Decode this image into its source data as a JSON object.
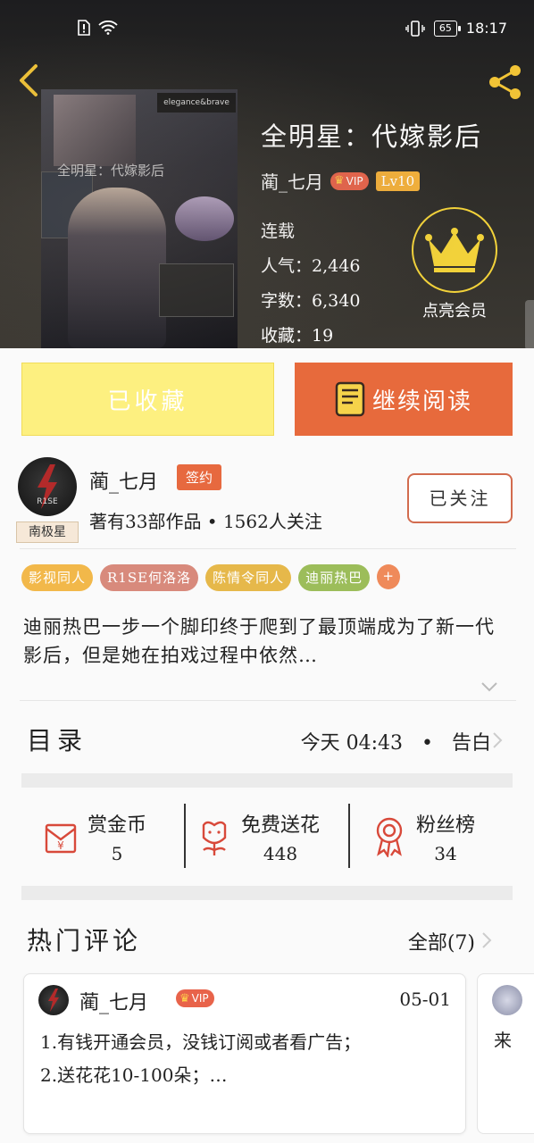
{
  "statusbar": {
    "time": "18:17",
    "battery": "65"
  },
  "book": {
    "title": "全明星：代嫁影后",
    "author": "蔺_七月",
    "vip_label": "VIP",
    "level": "Lv10",
    "cover_text": "elegance&brave",
    "cover_title": "全明星：代嫁影后",
    "status": "连载",
    "popularity_label": "人气：",
    "popularity": "2,446",
    "words_label": "字数：",
    "words": "6,340",
    "favorites_label": "收藏：",
    "favorites": "19"
  },
  "vip_member": {
    "label": "点亮会员"
  },
  "actions": {
    "collected": "已收藏",
    "continue_reading": "继续阅读"
  },
  "author_card": {
    "name": "蔺_七月",
    "signed": "签约",
    "avatar_tag": "南极星",
    "avatar_text": "R1SE",
    "meta": "著有33部作品 • 1562人关注",
    "follow": "已关注"
  },
  "tags": [
    {
      "label": "影视同人",
      "color": "#f2b84a"
    },
    {
      "label": "R1SE何洛洛",
      "color": "#d88a7c"
    },
    {
      "label": "陈情令同人",
      "color": "#e6b84a"
    },
    {
      "label": "迪丽热巴",
      "color": "#9cbd5a"
    },
    {
      "label": "+",
      "color": "#ef8a5a"
    }
  ],
  "synopsis": "迪丽热巴一步一个脚印终于爬到了最顶端成为了新一代影后，但是她在拍戏过程中依然…",
  "toc": {
    "title": "目录",
    "latest_time": "今天 04:43",
    "separator": "•",
    "latest_chapter": "告白"
  },
  "rewards": [
    {
      "label": "赏金币",
      "value": "5",
      "icon": "red-envelope-icon"
    },
    {
      "label": "免费送花",
      "value": "448",
      "icon": "flower-icon"
    },
    {
      "label": "粉丝榜",
      "value": "34",
      "icon": "medal-icon"
    }
  ],
  "comments": {
    "title": "热门评论",
    "all_label": "全部(7)",
    "first": {
      "name": "蔺_七月",
      "vip": "VIP",
      "date": "05-01",
      "line1": "1.有钱开通会员，没钱订阅或者看广告；",
      "line2": "2.送花花10-100朵；…"
    },
    "second_preview": "来"
  },
  "colors": {
    "accent_orange": "#e76a3c",
    "collect_yellow": "#fdf080",
    "crown_gold": "#f2d23a"
  }
}
